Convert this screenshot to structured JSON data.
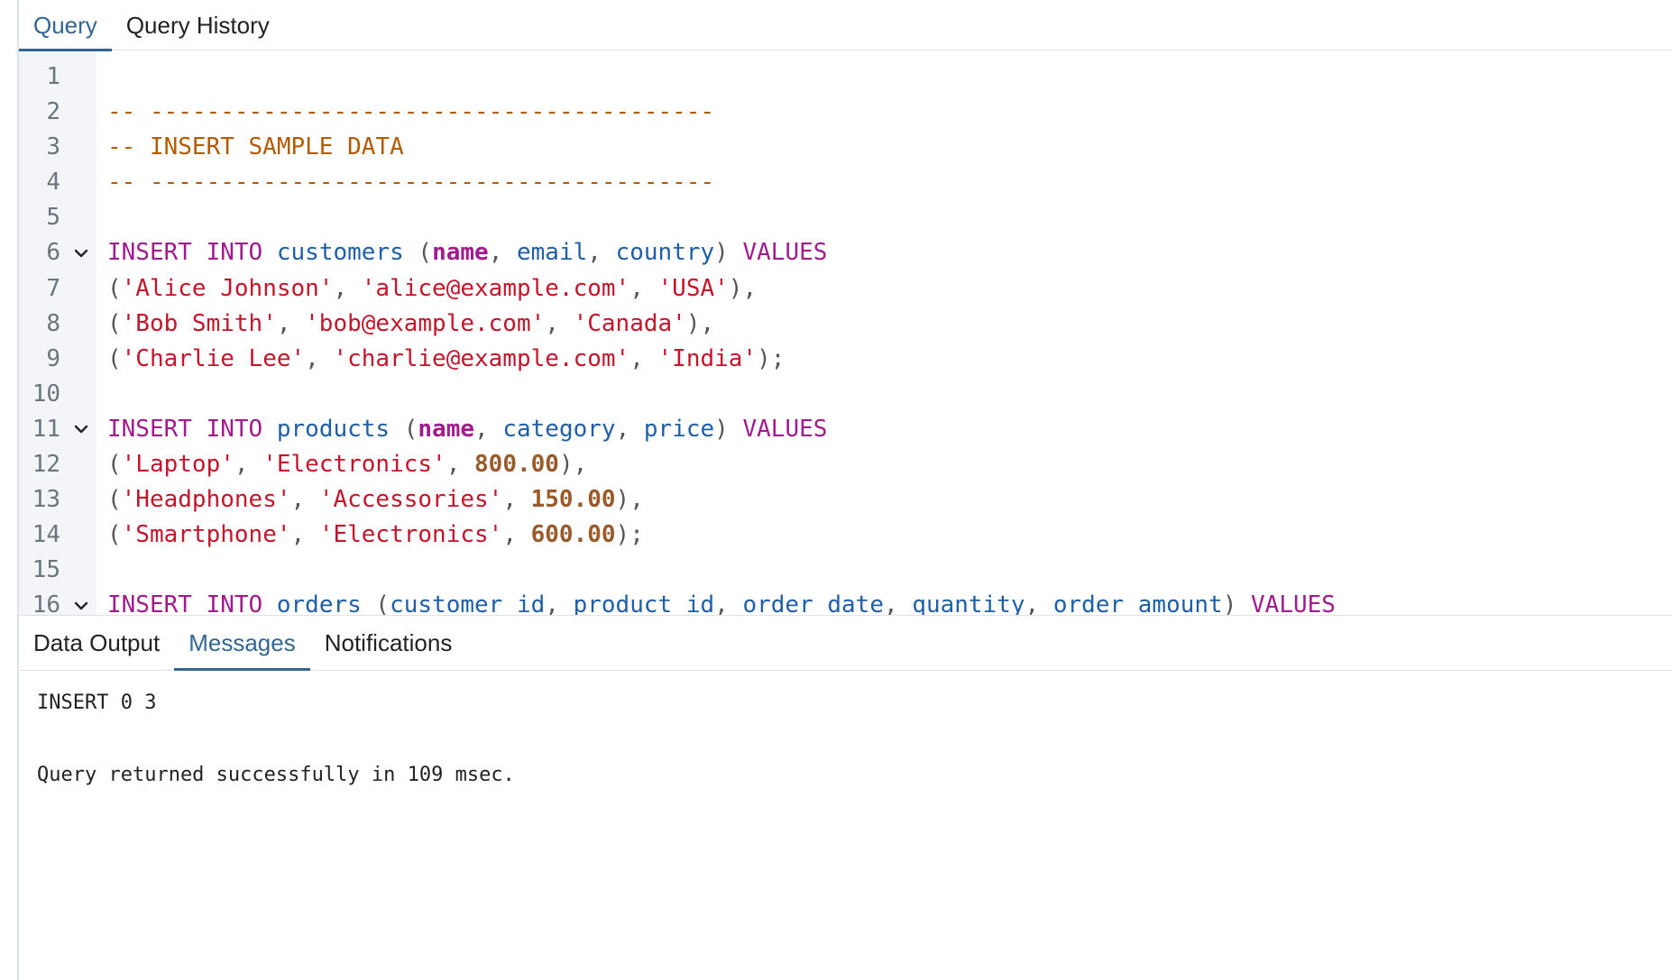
{
  "top_tabs": [
    "Query",
    "Query History"
  ],
  "active_top_tab": 0,
  "editor": {
    "lines": [
      {
        "n": "1",
        "fold": false,
        "tokens": []
      },
      {
        "n": "2",
        "fold": false,
        "tokens": [
          {
            "t": "comment",
            "v": "-- ----------------------------------------"
          }
        ]
      },
      {
        "n": "3",
        "fold": false,
        "tokens": [
          {
            "t": "comment",
            "v": "-- INSERT SAMPLE DATA"
          }
        ]
      },
      {
        "n": "4",
        "fold": false,
        "tokens": [
          {
            "t": "comment",
            "v": "-- ----------------------------------------"
          }
        ]
      },
      {
        "n": "5",
        "fold": false,
        "tokens": []
      },
      {
        "n": "6",
        "fold": true,
        "tokens": [
          {
            "t": "keyword",
            "v": "INSERT"
          },
          {
            "t": "punct",
            "v": " "
          },
          {
            "t": "keyword",
            "v": "INTO"
          },
          {
            "t": "punct",
            "v": " "
          },
          {
            "t": "table",
            "v": "customers"
          },
          {
            "t": "punct",
            "v": " ("
          },
          {
            "t": "bcol",
            "v": "name"
          },
          {
            "t": "punct",
            "v": ", "
          },
          {
            "t": "col",
            "v": "email"
          },
          {
            "t": "punct",
            "v": ", "
          },
          {
            "t": "col",
            "v": "country"
          },
          {
            "t": "punct",
            "v": ") "
          },
          {
            "t": "keyword",
            "v": "VALUES"
          }
        ]
      },
      {
        "n": "7",
        "fold": false,
        "tokens": [
          {
            "t": "punct",
            "v": "("
          },
          {
            "t": "string",
            "v": "'Alice Johnson'"
          },
          {
            "t": "punct",
            "v": ", "
          },
          {
            "t": "string",
            "v": "'alice@example.com'"
          },
          {
            "t": "punct",
            "v": ", "
          },
          {
            "t": "string",
            "v": "'USA'"
          },
          {
            "t": "punct",
            "v": "),"
          }
        ]
      },
      {
        "n": "8",
        "fold": false,
        "tokens": [
          {
            "t": "punct",
            "v": "("
          },
          {
            "t": "string",
            "v": "'Bob Smith'"
          },
          {
            "t": "punct",
            "v": ", "
          },
          {
            "t": "string",
            "v": "'bob@example.com'"
          },
          {
            "t": "punct",
            "v": ", "
          },
          {
            "t": "string",
            "v": "'Canada'"
          },
          {
            "t": "punct",
            "v": "),"
          }
        ]
      },
      {
        "n": "9",
        "fold": false,
        "tokens": [
          {
            "t": "punct",
            "v": "("
          },
          {
            "t": "string",
            "v": "'Charlie Lee'"
          },
          {
            "t": "punct",
            "v": ", "
          },
          {
            "t": "string",
            "v": "'charlie@example.com'"
          },
          {
            "t": "punct",
            "v": ", "
          },
          {
            "t": "string",
            "v": "'India'"
          },
          {
            "t": "punct",
            "v": ");"
          }
        ]
      },
      {
        "n": "10",
        "fold": false,
        "tokens": []
      },
      {
        "n": "11",
        "fold": true,
        "tokens": [
          {
            "t": "keyword",
            "v": "INSERT"
          },
          {
            "t": "punct",
            "v": " "
          },
          {
            "t": "keyword",
            "v": "INTO"
          },
          {
            "t": "punct",
            "v": " "
          },
          {
            "t": "table",
            "v": "products"
          },
          {
            "t": "punct",
            "v": " ("
          },
          {
            "t": "bcol",
            "v": "name"
          },
          {
            "t": "punct",
            "v": ", "
          },
          {
            "t": "col",
            "v": "category"
          },
          {
            "t": "punct",
            "v": ", "
          },
          {
            "t": "col",
            "v": "price"
          },
          {
            "t": "punct",
            "v": ") "
          },
          {
            "t": "keyword",
            "v": "VALUES"
          }
        ]
      },
      {
        "n": "12",
        "fold": false,
        "tokens": [
          {
            "t": "punct",
            "v": "("
          },
          {
            "t": "string",
            "v": "'Laptop'"
          },
          {
            "t": "punct",
            "v": ", "
          },
          {
            "t": "string",
            "v": "'Electronics'"
          },
          {
            "t": "punct",
            "v": ", "
          },
          {
            "t": "number",
            "v": "800.00"
          },
          {
            "t": "punct",
            "v": "),"
          }
        ]
      },
      {
        "n": "13",
        "fold": false,
        "tokens": [
          {
            "t": "punct",
            "v": "("
          },
          {
            "t": "string",
            "v": "'Headphones'"
          },
          {
            "t": "punct",
            "v": ", "
          },
          {
            "t": "string",
            "v": "'Accessories'"
          },
          {
            "t": "punct",
            "v": ", "
          },
          {
            "t": "number",
            "v": "150.00"
          },
          {
            "t": "punct",
            "v": "),"
          }
        ]
      },
      {
        "n": "14",
        "fold": false,
        "tokens": [
          {
            "t": "punct",
            "v": "("
          },
          {
            "t": "string",
            "v": "'Smartphone'"
          },
          {
            "t": "punct",
            "v": ", "
          },
          {
            "t": "string",
            "v": "'Electronics'"
          },
          {
            "t": "punct",
            "v": ", "
          },
          {
            "t": "number",
            "v": "600.00"
          },
          {
            "t": "punct",
            "v": ");"
          }
        ]
      },
      {
        "n": "15",
        "fold": false,
        "tokens": []
      },
      {
        "n": "16",
        "fold": true,
        "tokens": [
          {
            "t": "keyword",
            "v": "INSERT"
          },
          {
            "t": "punct",
            "v": " "
          },
          {
            "t": "keyword",
            "v": "INTO"
          },
          {
            "t": "punct",
            "v": " "
          },
          {
            "t": "table",
            "v": "orders"
          },
          {
            "t": "punct",
            "v": " ("
          },
          {
            "t": "col",
            "v": "customer_id"
          },
          {
            "t": "punct",
            "v": ", "
          },
          {
            "t": "col",
            "v": "product_id"
          },
          {
            "t": "punct",
            "v": ", "
          },
          {
            "t": "col",
            "v": "order_date"
          },
          {
            "t": "punct",
            "v": ", "
          },
          {
            "t": "col",
            "v": "quantity"
          },
          {
            "t": "punct",
            "v": ", "
          },
          {
            "t": "col",
            "v": "order_amount"
          },
          {
            "t": "punct",
            "v": ") "
          },
          {
            "t": "keyword",
            "v": "VALUES"
          }
        ]
      }
    ]
  },
  "output_tabs": [
    "Data Output",
    "Messages",
    "Notifications"
  ],
  "active_output_tab": 1,
  "messages": {
    "line1": "INSERT 0 3",
    "line2": "Query returned successfully in 109 msec."
  },
  "colors": {
    "accent": "#326690",
    "comment": "#b25b00",
    "keyword": "#a11b8f",
    "identifier": "#1f5fa8",
    "string": "#c4152b",
    "number": "#9a5a2a",
    "gutter": "#f3f5f9"
  },
  "icons": {
    "fold": "chevron-down-icon"
  }
}
